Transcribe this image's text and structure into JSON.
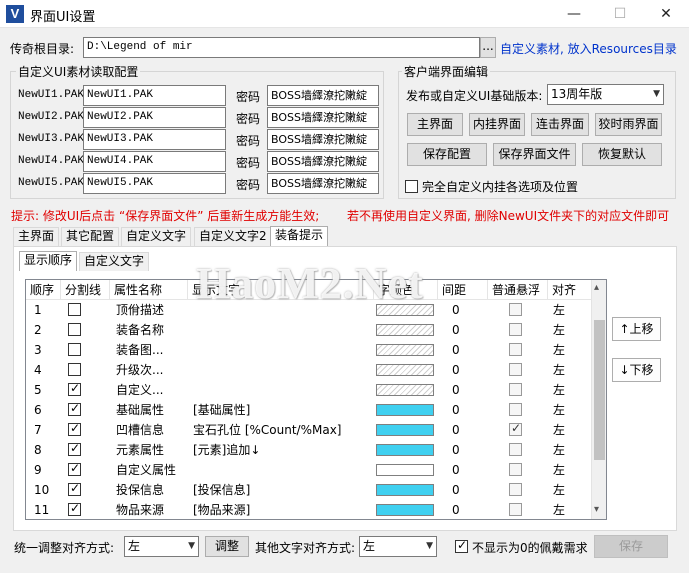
{
  "window": {
    "title": "界面UI设置",
    "logo": "V",
    "minimize": "—",
    "maximize": "☐",
    "close": "✕"
  },
  "root": {
    "label": "传奇根目录:",
    "path": "D:\\Legend of mir",
    "browse": "...",
    "hint": "自定义素材, 放入Resources目录"
  },
  "custom_ui": {
    "title": "自定义UI素材读取配置",
    "password_label": "密码",
    "rows": [
      {
        "label": "NewUI1.PAK",
        "value": "NewUI1.PAK",
        "password": "BOSS墙繹潦拕敶綻"
      },
      {
        "label": "NewUI2.PAK",
        "value": "NewUI2.PAK",
        "password": "BOSS墙繹潦拕敶綻"
      },
      {
        "label": "NewUI3.PAK",
        "value": "NewUI3.PAK",
        "password": "BOSS墙繹潦拕敶綻"
      },
      {
        "label": "NewUI4.PAK",
        "value": "NewUI4.PAK",
        "password": "BOSS墙繹潦拕敶綻"
      },
      {
        "label": "NewUI5.PAK",
        "value": "NewUI5.PAK",
        "password": "BOSS墙繹潦拕敶綻"
      }
    ]
  },
  "client_edit": {
    "title": "客户端界面编辑",
    "version_label": "发布或自定义UI基础版本:",
    "version_value": "13周年版",
    "buttons": [
      "主界面",
      "内挂界面",
      "连击界面",
      "狡时雨界面"
    ],
    "save_config": "保存配置",
    "save_ui_file": "保存界面文件",
    "restore_default": "恢复默认",
    "full_custom_label": "完全自定义内挂各选项及位置",
    "full_custom_checked": false
  },
  "tip": {
    "left": "提示: 修改UI后点击 “保存界面文件” 后重新生成方能生效;",
    "right": "若不再使用自定义界面, 删除NewUI文件夹下的对应文件即可"
  },
  "tabs": [
    "主界面",
    "其它配置",
    "自定义文字",
    "自定义文字2",
    "装备提示"
  ],
  "active_tab": 4,
  "subtabs": [
    "显示顺序",
    "自定义文字"
  ],
  "active_subtab": 0,
  "watermark": "HaoM2.Net",
  "table": {
    "headers": [
      "顺序",
      "分割线",
      "属性名称",
      "显示文字",
      "字颜色",
      "间距",
      "普通悬浮",
      "对齐"
    ],
    "rows": [
      {
        "order": "1",
        "divider": false,
        "name": "顶佾描述",
        "text": "",
        "color": "hatch",
        "spacing": "0",
        "hover": false,
        "align": "左"
      },
      {
        "order": "2",
        "divider": false,
        "name": "装备名称",
        "text": "",
        "color": "hatch",
        "spacing": "0",
        "hover": false,
        "align": "左"
      },
      {
        "order": "3",
        "divider": false,
        "name": "装备图...",
        "text": "",
        "color": "hatch",
        "spacing": "0",
        "hover": false,
        "align": "左"
      },
      {
        "order": "4",
        "divider": false,
        "name": "升级次...",
        "text": "",
        "color": "hatch",
        "spacing": "0",
        "hover": false,
        "align": "左"
      },
      {
        "order": "5",
        "divider": true,
        "name": "自定义...",
        "text": "",
        "color": "hatch",
        "spacing": "0",
        "hover": false,
        "align": "左"
      },
      {
        "order": "6",
        "divider": true,
        "name": "基础属性",
        "text": "[基础属性]",
        "color": "#3fd0f0",
        "spacing": "0",
        "hover": false,
        "align": "左"
      },
      {
        "order": "7",
        "divider": true,
        "name": "凹槽信息",
        "text": "宝石孔位 [%Count/%Max]",
        "color": "#3fd0f0",
        "spacing": "0",
        "hover": true,
        "align": "左"
      },
      {
        "order": "8",
        "divider": true,
        "name": "元素属性",
        "text": "[元素]追加↓",
        "color": "#3fd0f0",
        "spacing": "0",
        "hover": false,
        "align": "左"
      },
      {
        "order": "9",
        "divider": true,
        "name": "自定义属性",
        "text": "",
        "color": "#ffffff",
        "spacing": "0",
        "hover": false,
        "align": "左"
      },
      {
        "order": "10",
        "divider": true,
        "name": "投保信息",
        "text": "[投保信息]",
        "color": "#3fd0f0",
        "spacing": "0",
        "hover": false,
        "align": "左"
      },
      {
        "order": "11",
        "divider": true,
        "name": "物品来源",
        "text": "[物品来源]",
        "color": "#3fd0f0",
        "spacing": "0",
        "hover": false,
        "align": "左"
      }
    ]
  },
  "move_up": "↑上移",
  "move_down": "↓下移",
  "bottom": {
    "align_label": "统一调整对齐方式:",
    "align_value": "左",
    "adjust_button": "调整",
    "other_align_label": "其他文字对齐方式:",
    "other_align_value": "左",
    "hide_zero_label": "不显示为0的佩戴需求",
    "hide_zero_checked": true,
    "save_button": "保存"
  },
  "scroll": {
    "up": "▴",
    "down": "▾"
  },
  "dropdown_arrow": "▼"
}
